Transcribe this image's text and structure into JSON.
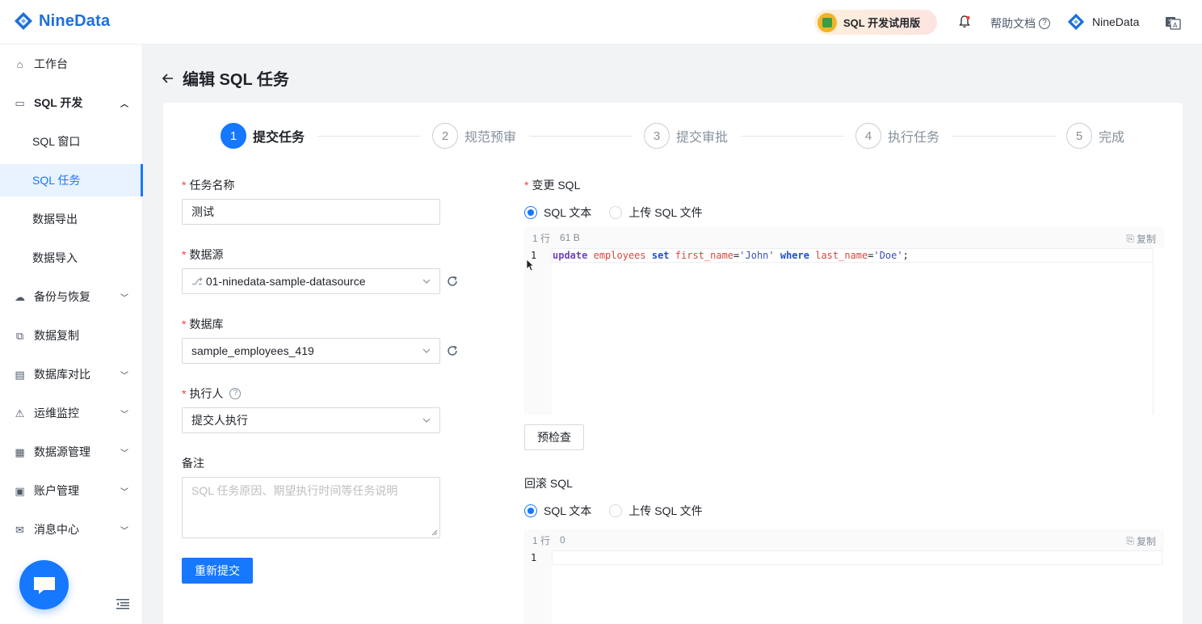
{
  "header": {
    "brand": "NineData",
    "trial_label": "SQL 开发试用版",
    "help_label": "帮助文档",
    "help_glyph": "?",
    "user_name": "NineData"
  },
  "sidebar": {
    "items": [
      {
        "label": "工作台",
        "icon": "home-icon"
      },
      {
        "label": "SQL 开发",
        "icon": "monitor-icon"
      },
      {
        "label": "SQL 窗口"
      },
      {
        "label": "SQL 任务"
      },
      {
        "label": "数据导出"
      },
      {
        "label": "数据导入"
      },
      {
        "label": "备份与恢复",
        "icon": "cloud-icon"
      },
      {
        "label": "数据复制",
        "icon": "copy-data-icon"
      },
      {
        "label": "数据库对比",
        "icon": "compare-icon"
      },
      {
        "label": "运维监控",
        "icon": "alarm-icon"
      },
      {
        "label": "数据源管理",
        "icon": "datasource-icon"
      },
      {
        "label": "账户管理",
        "icon": "account-icon"
      },
      {
        "label": "消息中心",
        "icon": "mail-icon"
      }
    ]
  },
  "page": {
    "title": "编辑 SQL 任务"
  },
  "steps": [
    {
      "num": "1",
      "label": "提交任务"
    },
    {
      "num": "2",
      "label": "规范预审"
    },
    {
      "num": "3",
      "label": "提交审批"
    },
    {
      "num": "4",
      "label": "执行任务"
    },
    {
      "num": "5",
      "label": "完成"
    }
  ],
  "form": {
    "task_name_label": "任务名称",
    "task_name_value": "测试",
    "datasource_label": "数据源",
    "datasource_value": "01-ninedata-sample-datasource",
    "database_label": "数据库",
    "database_value": "sample_employees_419",
    "executor_label": "执行人",
    "executor_value": "提交人执行",
    "note_label": "备注",
    "note_placeholder": "SQL 任务原因、期望执行时间等任务说明",
    "resubmit_label": "重新提交"
  },
  "change_sql": {
    "label": "变更 SQL",
    "radio_text": "SQL 文本",
    "radio_upload": "上传 SQL 文件",
    "line_count": "1 行",
    "size": "61 B",
    "copy_label": "复制",
    "line_no": "1",
    "code": {
      "kw_update": "update",
      "table": "employees",
      "kw_set": "set",
      "col1": "first_name",
      "eq1": "=",
      "val1": "'John'",
      "kw_where": "where",
      "col2": "last_name",
      "eq2": "=",
      "val2": "'Doe'",
      "end": ";"
    },
    "precheck_label": "预检查"
  },
  "rollback_sql": {
    "label": "回滚 SQL",
    "radio_text": "SQL 文本",
    "radio_upload": "上传 SQL 文件",
    "line_count": "1 行",
    "size": "0",
    "copy_label": "复制",
    "line_no": "1"
  }
}
